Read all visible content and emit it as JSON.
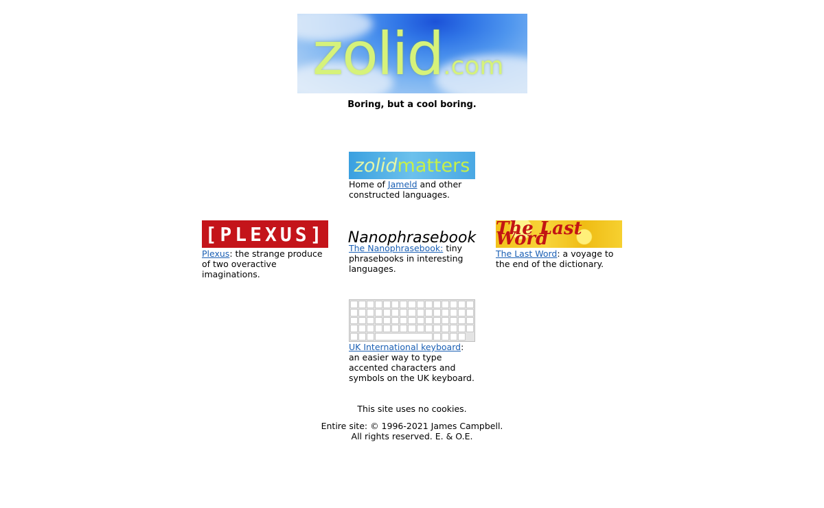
{
  "header": {
    "logo_text": "zolid",
    "logo_suffix": ".com",
    "tagline": "Boring, but a cool boring."
  },
  "tiles": {
    "zolidmatters": {
      "logo_part1": "zolid",
      "logo_part2": "matters",
      "desc_before": "Home of ",
      "link": "Jameld",
      "desc_after": " and other constructed languages."
    },
    "plexus": {
      "logo": "[PLEXUS]",
      "link": "Plexus",
      "desc_after": ": the strange produce of two overactive imaginations."
    },
    "nanophrasebook": {
      "logo": "Nanophrasebook",
      "link": "The Nanophrasebook:",
      "desc_after": " tiny phrasebooks in interesting languages."
    },
    "lastword": {
      "logo": "The Last Word",
      "link": "The Last Word",
      "desc_after": ": a voyage to the end of the dictionary."
    },
    "keyboard": {
      "link": "UK International keyboard",
      "desc_after": ": an easier way to type accented characters and symbols on the UK keyboard."
    }
  },
  "footer": {
    "cookies": "This site uses no cookies.",
    "copyright_line1": "Entire site: © 1996-2021 James Campbell.",
    "copyright_line2": "All rights reserved. E. & O.E."
  },
  "colors": {
    "link": "#1a5fb4",
    "plexus_red": "#c4141a",
    "lastword_red": "#c21414"
  }
}
